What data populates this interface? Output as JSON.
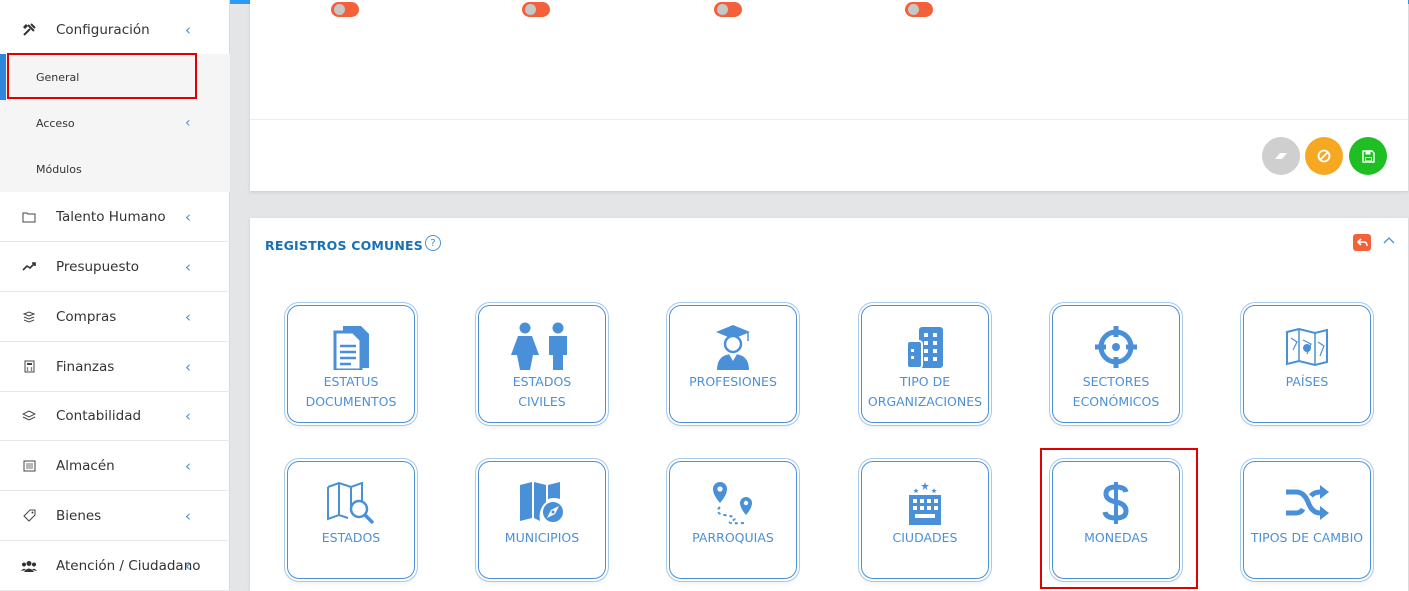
{
  "sidebar": {
    "configuracion": "Configuración",
    "sub": {
      "general": "General",
      "acceso": "Acceso",
      "modulos": "Módulos"
    },
    "items": [
      {
        "label": "Talento Humano",
        "icon": "folder-icon"
      },
      {
        "label": "Presupuesto",
        "icon": "trend-icon"
      },
      {
        "label": "Compras",
        "icon": "tags-icon"
      },
      {
        "label": "Finanzas",
        "icon": "calculator-icon"
      },
      {
        "label": "Contabilidad",
        "icon": "layers-icon"
      },
      {
        "label": "Almacén",
        "icon": "list-icon"
      },
      {
        "label": "Bienes",
        "icon": "tag-icon"
      },
      {
        "label": "Atención / Ciudadano",
        "icon": "users-icon"
      }
    ]
  },
  "registros": {
    "title": "REGISTROS COMUNES",
    "help": "?",
    "tiles": [
      {
        "l1": "ESTATUS",
        "l2": "DOCUMENTOS"
      },
      {
        "l1": "ESTADOS",
        "l2": "CIVILES"
      },
      {
        "l1": "PROFESIONES",
        "l2": ""
      },
      {
        "l1": "TIPO DE",
        "l2": "ORGANIZACIONES"
      },
      {
        "l1": "SECTORES",
        "l2": "ECONÓMICOS"
      },
      {
        "l1": "PAÍSES",
        "l2": ""
      },
      {
        "l1": "ESTADOS",
        "l2": ""
      },
      {
        "l1": "MUNICIPIOS",
        "l2": ""
      },
      {
        "l1": "PARROQUIAS",
        "l2": ""
      },
      {
        "l1": "CIUDADES",
        "l2": ""
      },
      {
        "l1": "MONEDAS",
        "l2": ""
      },
      {
        "l1": "TIPOS DE CAMBIO",
        "l2": ""
      }
    ]
  },
  "colors": {
    "accent": "#4a90d9",
    "toggle": "#f2613a",
    "clear_btn": "#cfcfcf",
    "cancel_btn": "#f7a823",
    "save_btn": "#1fbf24",
    "highlight": "#e00000"
  }
}
